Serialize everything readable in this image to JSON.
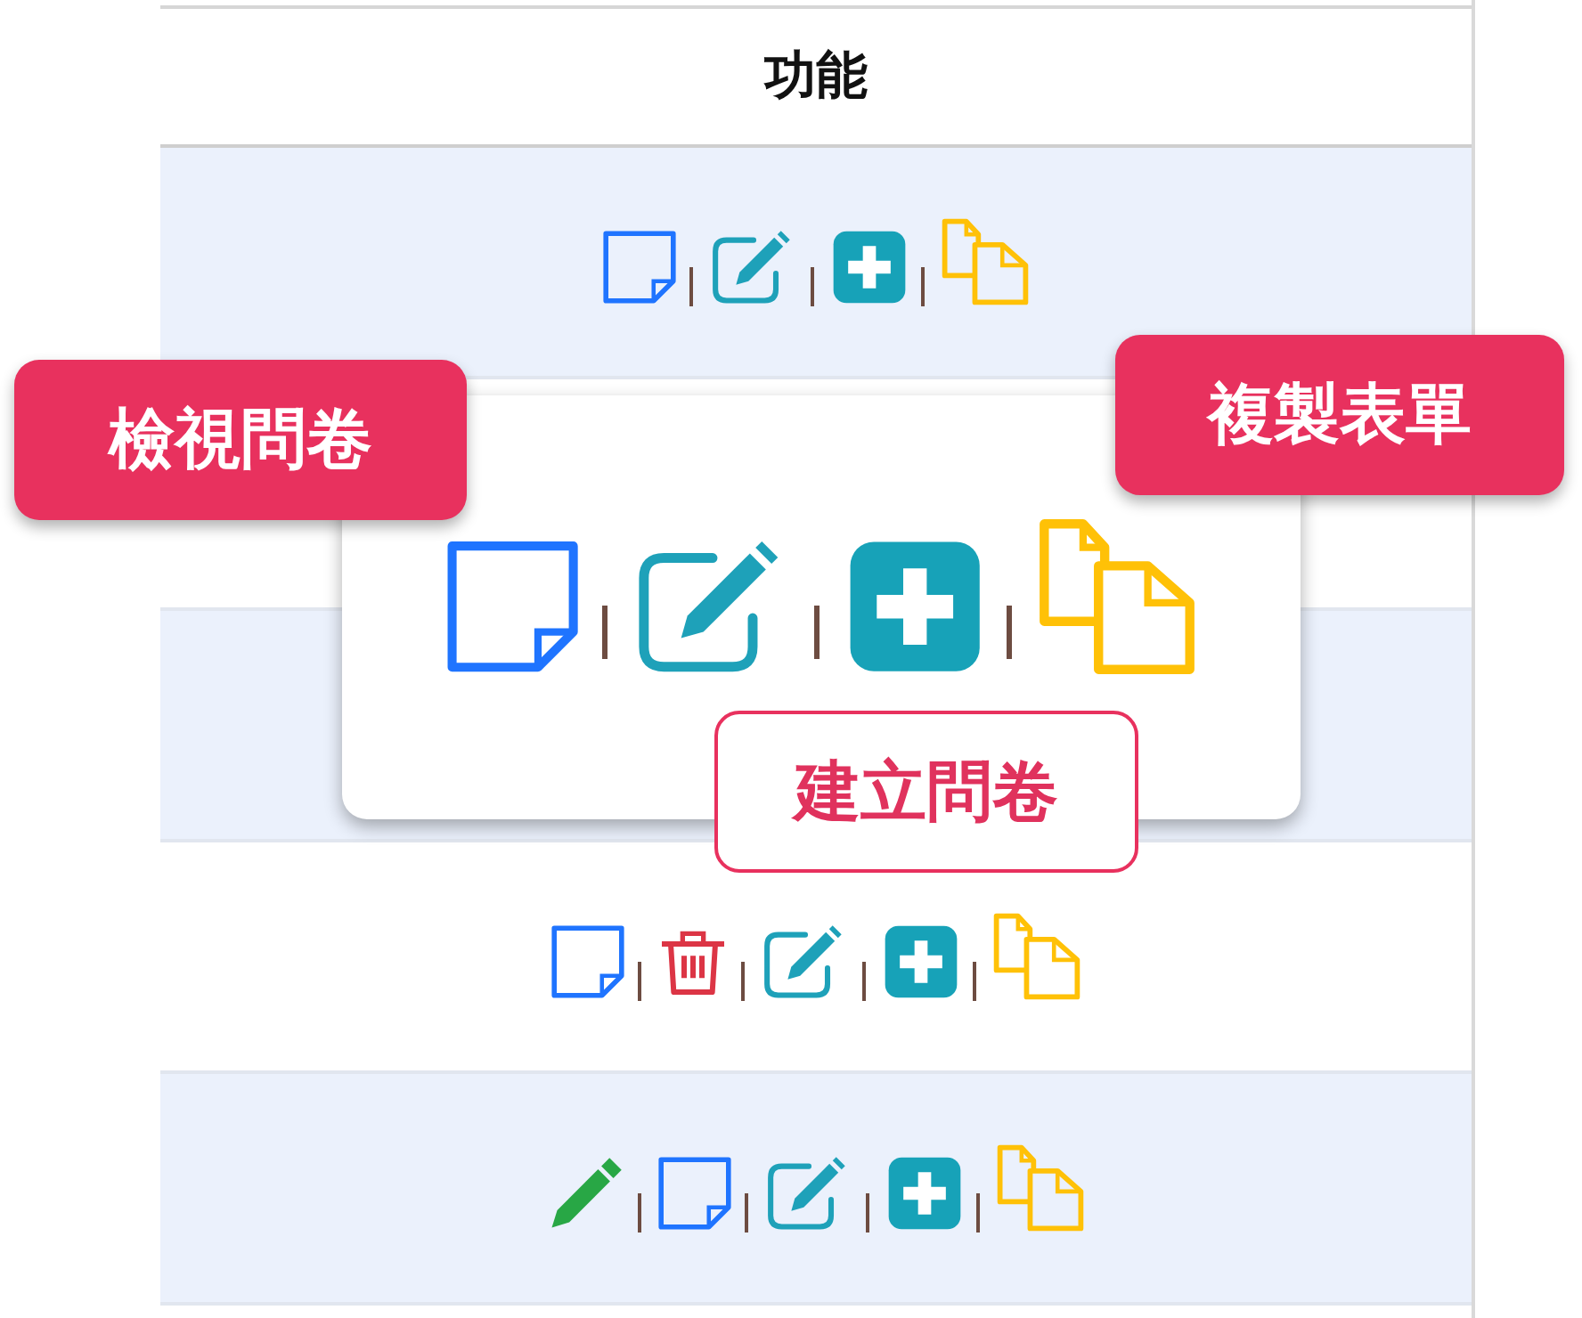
{
  "table": {
    "columns": [
      {
        "label": "功能"
      }
    ],
    "rows": [
      {
        "actions": [
          {
            "kind": "view"
          },
          {
            "kind": "edit"
          },
          {
            "kind": "add"
          },
          {
            "kind": "copy"
          }
        ]
      },
      {},
      {},
      {
        "actions": [
          {
            "kind": "view"
          },
          {
            "kind": "delete"
          },
          {
            "kind": "edit"
          },
          {
            "kind": "add"
          },
          {
            "kind": "copy"
          }
        ]
      },
      {
        "actions": [
          {
            "kind": "pencil"
          },
          {
            "kind": "view"
          },
          {
            "kind": "edit"
          },
          {
            "kind": "add"
          },
          {
            "kind": "copy"
          }
        ]
      }
    ]
  },
  "magnifier": {
    "actions": [
      {
        "kind": "view"
      },
      {
        "kind": "edit"
      },
      {
        "kind": "add"
      },
      {
        "kind": "copy"
      }
    ]
  },
  "callouts": [
    {
      "label": "檢視問卷",
      "kind": "filled"
    },
    {
      "label": "複製表單",
      "kind": "filled"
    },
    {
      "label": "建立問卷",
      "kind": "outline"
    }
  ]
}
